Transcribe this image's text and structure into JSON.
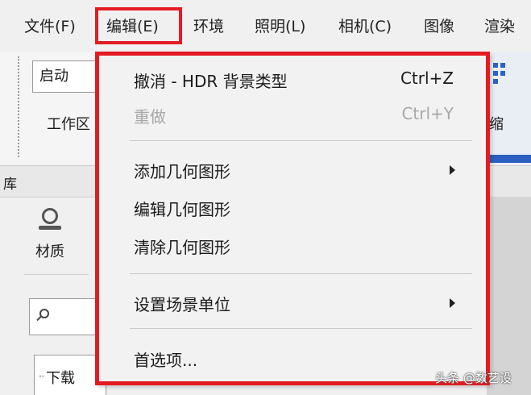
{
  "menubar": {
    "file": "文件(F)",
    "edit": "编辑(E)",
    "environment": "环境",
    "lighting": "照明(L)",
    "camera": "相机(C)",
    "image": "图像",
    "render": "渲染"
  },
  "toolbar": {
    "startup_value": "启动",
    "workspace_label": "工作区",
    "right_label": "缩"
  },
  "library": {
    "title": "库",
    "material_tab": "材质",
    "tree_item": "下载"
  },
  "edit_menu": {
    "items": [
      {
        "label": "撤消 - HDR 背景类型",
        "shortcut": "Ctrl+Z",
        "enabled": true
      },
      {
        "label": "重做",
        "shortcut": "Ctrl+Y",
        "enabled": false
      },
      {
        "label": "添加几何图形",
        "submenu": true
      },
      {
        "label": "编辑几何图形"
      },
      {
        "label": "清除几何图形"
      },
      {
        "label": "设置场景单位",
        "submenu": true
      },
      {
        "label": "首选项..."
      }
    ]
  },
  "watermark": "头条 @数艺设",
  "colors": {
    "highlight_border": "#e31b23",
    "accent_blue": "#2b5fc1",
    "disabled_text": "#a8a8a8"
  }
}
